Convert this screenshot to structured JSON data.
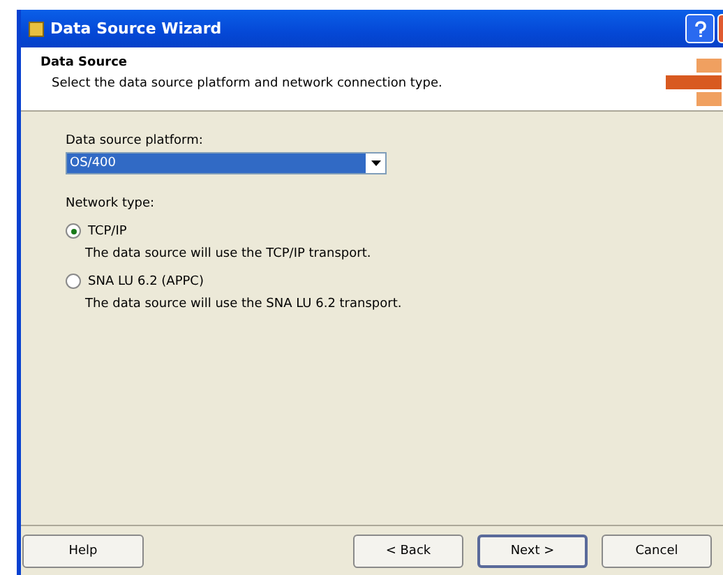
{
  "window": {
    "title": "Data Source Wizard"
  },
  "header": {
    "title": "Data Source",
    "subtitle": "Select the data source platform and network connection type."
  },
  "platform": {
    "label": "Data source platform:",
    "value": "OS/400"
  },
  "network": {
    "label": "Network type:",
    "options": [
      {
        "label": "TCP/IP",
        "description": "The data source will use the TCP/IP transport.",
        "selected": true
      },
      {
        "label": "SNA LU 6.2 (APPC)",
        "description": "The data source will use the SNA LU 6.2 transport.",
        "selected": false
      }
    ]
  },
  "buttons": [
    {
      "label": "Help",
      "kind": "help"
    },
    {
      "label": "< Back",
      "kind": "nav"
    },
    {
      "label": "Next >",
      "kind": "default"
    },
    {
      "label": "Cancel",
      "kind": "nav"
    }
  ]
}
